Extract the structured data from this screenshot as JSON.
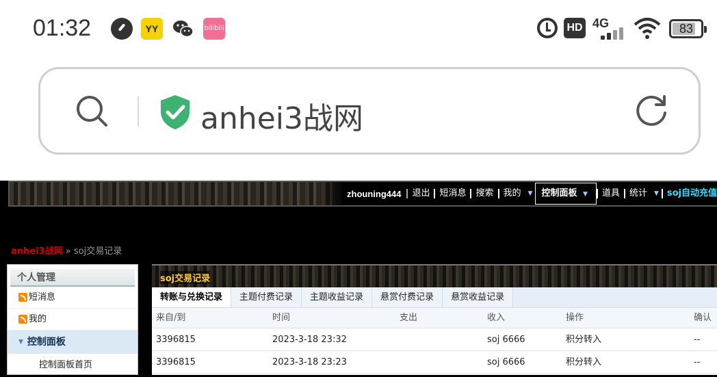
{
  "status": {
    "time": "01:32",
    "network": "4G",
    "battery": "83",
    "battery_level": 0.83,
    "icons": [
      "speedometer-icon",
      "yy-app-icon",
      "wechat-icon",
      "bilibili-icon",
      "alarm-icon",
      "hd-icon",
      "signal-icon",
      "wifi-icon",
      "battery-icon"
    ],
    "yy_label": "YY",
    "hd_label": "HD"
  },
  "address": {
    "site": "anhei3战网",
    "secure_color": "#3cb371"
  },
  "nav": {
    "user": "zhouning444",
    "links": [
      "退出",
      "短消息",
      "搜索",
      "我的"
    ],
    "panel": "控制面板",
    "links2": [
      "道具",
      "统计"
    ],
    "soj": "soj自动充值"
  },
  "breadcrumb": {
    "home": "anhei3战网",
    "sep": "»",
    "current": "soj交易记录"
  },
  "sidebar": {
    "title": "个人管理",
    "items": [
      {
        "label": "短消息"
      },
      {
        "label": "我的"
      }
    ],
    "active": "控制面板",
    "sub": "控制面板首页"
  },
  "main": {
    "title": "soj交易记录",
    "tabs": [
      "转账与兑换记录",
      "主题付费记录",
      "主题收益记录",
      "悬赏付费记录",
      "悬赏收益记录"
    ],
    "columns": [
      "来自/到",
      "时间",
      "支出",
      "收入",
      "操作",
      "确认"
    ],
    "rows": [
      [
        "3396815",
        "2023-3-18 23:32",
        "",
        "soj 6666",
        "积分转入",
        "--"
      ],
      [
        "3396815",
        "2023-3-18 23:23",
        "",
        "soj 6666",
        "积分转入",
        "--"
      ]
    ]
  }
}
